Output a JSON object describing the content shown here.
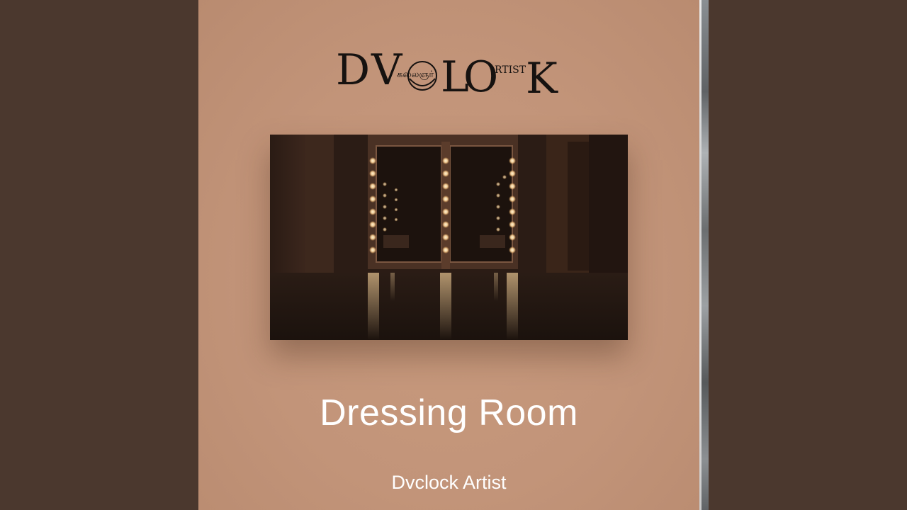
{
  "cover": {
    "logo_text": "DVCLOCK ARTIST",
    "title": "Dressing Room",
    "artist": "Dvclock Artist"
  },
  "colors": {
    "background": "#4b382e",
    "cover": "#c29479",
    "text": "#ffffff",
    "logo": "#161210",
    "bulb": "#ffd9a0"
  },
  "icons": [
    "dvclock-artist-logo"
  ]
}
